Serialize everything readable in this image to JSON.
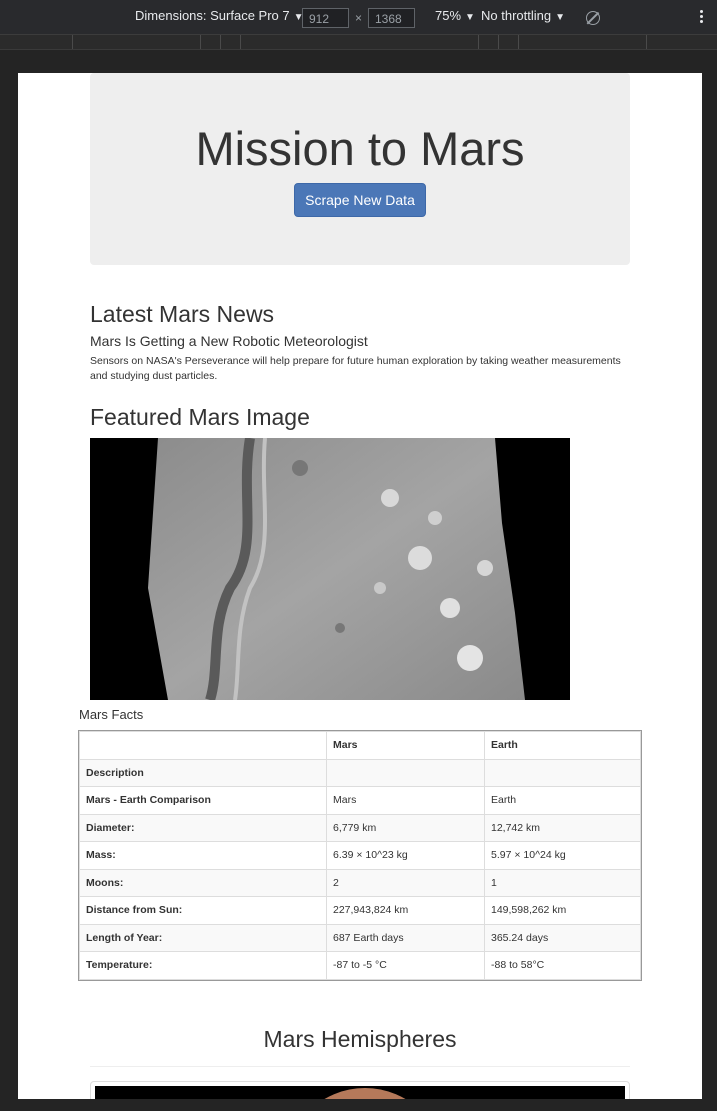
{
  "devtools": {
    "dimensions_label": "Dimensions: Surface Pro 7",
    "width_value": "912",
    "height_value": "1368",
    "times": "×",
    "zoom": "75%",
    "throttling": "No throttling",
    "caret": "▼"
  },
  "header": {
    "title": "Mission to Mars",
    "scrape_button": "Scrape New Data"
  },
  "news": {
    "heading": "Latest Mars News",
    "title": "Mars Is Getting a New Robotic Meteorologist",
    "paragraph": "Sensors on NASA's Perseverance will help prepare for future human exploration by taking weather measurements and studying dust particles."
  },
  "featured_image": {
    "heading": "Featured Mars Image"
  },
  "facts": {
    "label": "Mars Facts",
    "columns": [
      "",
      "Mars",
      "Earth"
    ],
    "rows": [
      [
        "Description",
        "",
        ""
      ],
      [
        "Mars - Earth Comparison",
        "Mars",
        "Earth"
      ],
      [
        "Diameter:",
        "6,779 km",
        "12,742 km"
      ],
      [
        "Mass:",
        "6.39 × 10^23 kg",
        "5.97 × 10^24 kg"
      ],
      [
        "Moons:",
        "2",
        "1"
      ],
      [
        "Distance from Sun:",
        "227,943,824 km",
        "149,598,262 km"
      ],
      [
        "Length of Year:",
        "687 Earth days",
        "365.24 days"
      ],
      [
        "Temperature:",
        "-87 to -5 °C",
        "-88 to 58°C"
      ]
    ]
  },
  "hemispheres": {
    "heading": "Mars Hemispheres"
  }
}
